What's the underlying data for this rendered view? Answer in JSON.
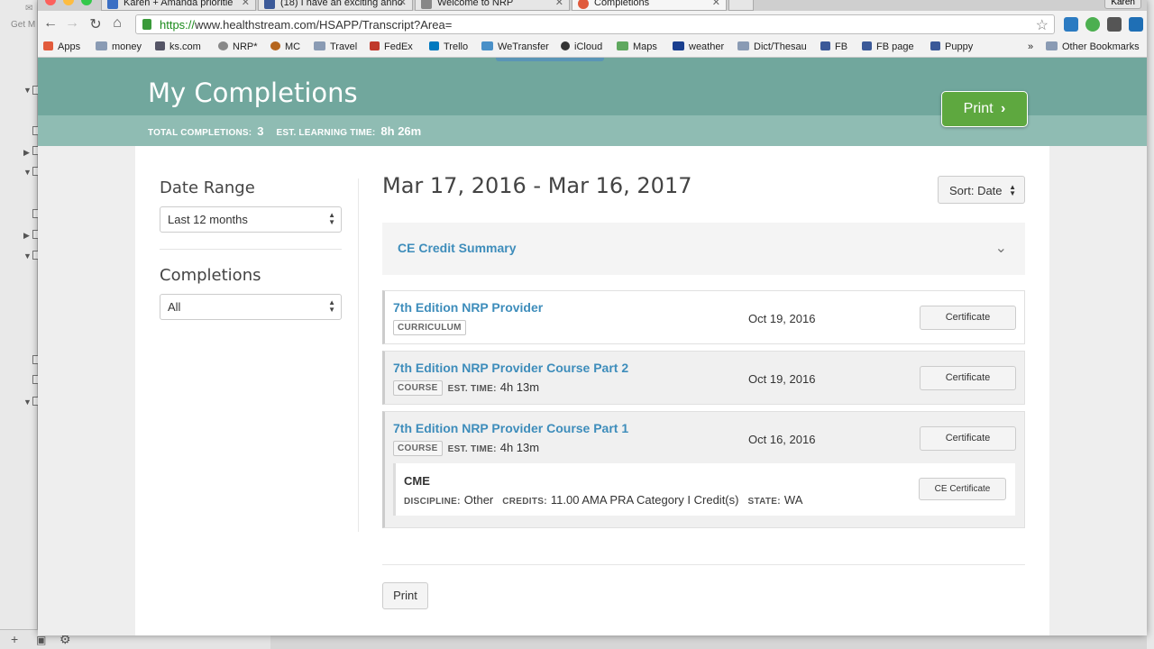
{
  "browser": {
    "tabs": [
      {
        "title": "Karen + Amanda prioritie",
        "fav_color": "#3b6fc4",
        "active": false
      },
      {
        "title": "(18) I have an exciting anno",
        "fav_color": "#3b5998",
        "active": false
      },
      {
        "title": "Welcome to NRP",
        "fav_color": "#888888",
        "active": false
      },
      {
        "title": "Completions",
        "fav_color": "#e05a3c",
        "active": true
      }
    ],
    "profile_name": "Karen",
    "url_scheme": "https://",
    "url_rest": "www.healthstream.com/HSAPP/Transcript?Area=",
    "bookmarks": [
      {
        "label": "Apps",
        "icon": "apps-grid-icon"
      },
      {
        "label": "money",
        "icon": "folder-icon"
      },
      {
        "label": "ks.com",
        "icon": "ks-icon"
      },
      {
        "label": "NRP*",
        "icon": "nrp-icon"
      },
      {
        "label": "MC",
        "icon": "mc-icon"
      },
      {
        "label": "Travel",
        "icon": "folder-icon"
      },
      {
        "label": "FedEx",
        "icon": "fedex-icon"
      },
      {
        "label": "Trello",
        "icon": "trello-icon"
      },
      {
        "label": "WeTransfer",
        "icon": "wetransfer-icon"
      },
      {
        "label": "iCloud",
        "icon": "apple-icon"
      },
      {
        "label": "Maps",
        "icon": "maps-icon"
      },
      {
        "label": "weather",
        "icon": "weather-icon"
      },
      {
        "label": "Dict/Thesau",
        "icon": "folder-icon"
      },
      {
        "label": "FB",
        "icon": "facebook-icon"
      },
      {
        "label": "FB page",
        "icon": "facebook-icon"
      },
      {
        "label": "Puppy",
        "icon": "facebook-icon"
      }
    ],
    "overflow_label": "»",
    "other_bookmarks": "Other Bookmarks"
  },
  "left_app": {
    "top_label": "Get M"
  },
  "page": {
    "title": "My Completions",
    "print_label": "Print",
    "stats": {
      "total_label": "TOTAL COMPLETIONS:",
      "total_value": "3",
      "time_label": "EST. LEARNING TIME:",
      "time_value": "8h 26m"
    },
    "filters": {
      "date_range_heading": "Date Range",
      "date_range_value": "Last 12 months",
      "completions_heading": "Completions",
      "completions_value": "All"
    },
    "range_heading": "Mar 17, 2016 - Mar 16, 2017",
    "sort_label": "Sort: Date",
    "ce_summary_label": "CE Credit Summary",
    "items": [
      {
        "title": "7th Edition NRP Provider",
        "type": "CURRICULUM",
        "est_label": "",
        "est_time": "",
        "date": "Oct 19, 2016",
        "button": "Certificate"
      },
      {
        "title": "7th Edition NRP Provider Course Part 2",
        "type": "COURSE",
        "est_label": "EST. TIME:",
        "est_time": "4h 13m",
        "date": "Oct 19, 2016",
        "button": "Certificate"
      },
      {
        "title": "7th Edition NRP Provider Course Part 1",
        "type": "COURSE",
        "est_label": "EST. TIME:",
        "est_time": "4h 13m",
        "date": "Oct 16, 2016",
        "button": "Certificate"
      }
    ],
    "cme": {
      "heading": "CME",
      "discipline_label": "DISCIPLINE:",
      "discipline_value": "Other",
      "credits_label": "CREDITS:",
      "credits_value": "11.00 AMA PRA Category I Credit(s)",
      "state_label": "STATE:",
      "state_value": "WA",
      "button": "CE Certificate"
    },
    "bottom_print_label": "Print"
  }
}
